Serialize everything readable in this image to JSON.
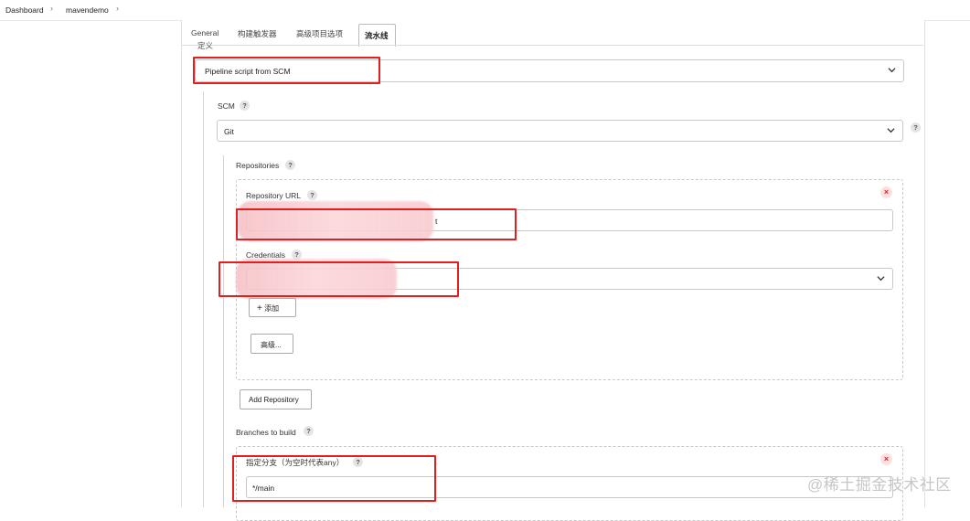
{
  "breadcrumb": {
    "items": [
      "Dashboard",
      "mavendemo"
    ]
  },
  "tabs": [
    {
      "label": "General"
    },
    {
      "label": "构建触发器"
    },
    {
      "label": "高级项目选项"
    },
    {
      "label": "流水线",
      "active": true
    }
  ],
  "definition": {
    "label": "定义",
    "selected": "Pipeline script from SCM"
  },
  "scm": {
    "label": "SCM",
    "selected": "Git"
  },
  "repositories": {
    "label": "Repositories",
    "repository_url": {
      "label": "Repository URL",
      "value": "t"
    },
    "credentials": {
      "label": "Credentials",
      "value": ""
    },
    "add_button": "添加",
    "advanced_button": "高级...",
    "add_repository_button": "Add Repository"
  },
  "branches": {
    "label": "Branches to build",
    "branch_specifier": {
      "label": "指定分支（为空时代表any）",
      "value": "*/main"
    }
  },
  "watermark": "@稀土掘金技术社区",
  "colors": {
    "highlight_box": "#e02020",
    "remove_icon": "#d12b2b"
  }
}
